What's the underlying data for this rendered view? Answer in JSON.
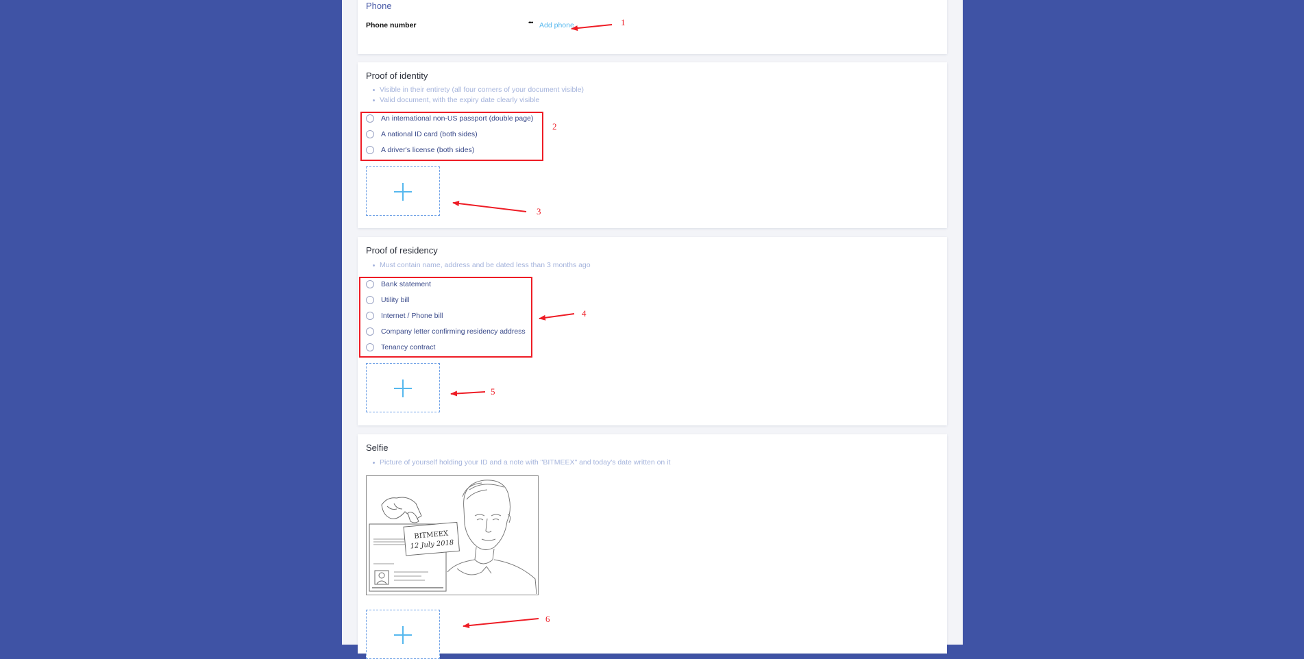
{
  "phone": {
    "title": "Phone",
    "field_label": "Phone number",
    "dots": "•••",
    "add_phone": "Add phone"
  },
  "identity": {
    "title": "Proof of identity",
    "bullets": [
      "Visible in their entirety (all four corners of your document visible)",
      "Valid document, with the expiry date clearly visible"
    ],
    "options": [
      "An international non-US passport (double page)",
      "A national ID card (both sides)",
      "A driver's license (both sides)"
    ]
  },
  "residency": {
    "title": "Proof of residency",
    "bullets": [
      "Must contain name, address and be dated less than 3 months ago"
    ],
    "options": [
      "Bank statement",
      "Utility bill",
      "Internet / Phone bill",
      "Company letter confirming residency address",
      "Tenancy contract"
    ]
  },
  "selfie": {
    "title": "Selfie",
    "bullets": [
      "Picture of yourself holding your ID and a note with \"BITMEEX\" and today's date written on it"
    ],
    "note_line1": "BITMEEX",
    "note_line2": "12 July 2018"
  },
  "annotations": [
    "1",
    "2",
    "3",
    "4",
    "5",
    "6"
  ],
  "colors": {
    "background": "#3f53a5",
    "annotation_red": "#ee1c25",
    "link_blue": "#56b8ee",
    "hint_text": "#a5b4dc"
  }
}
